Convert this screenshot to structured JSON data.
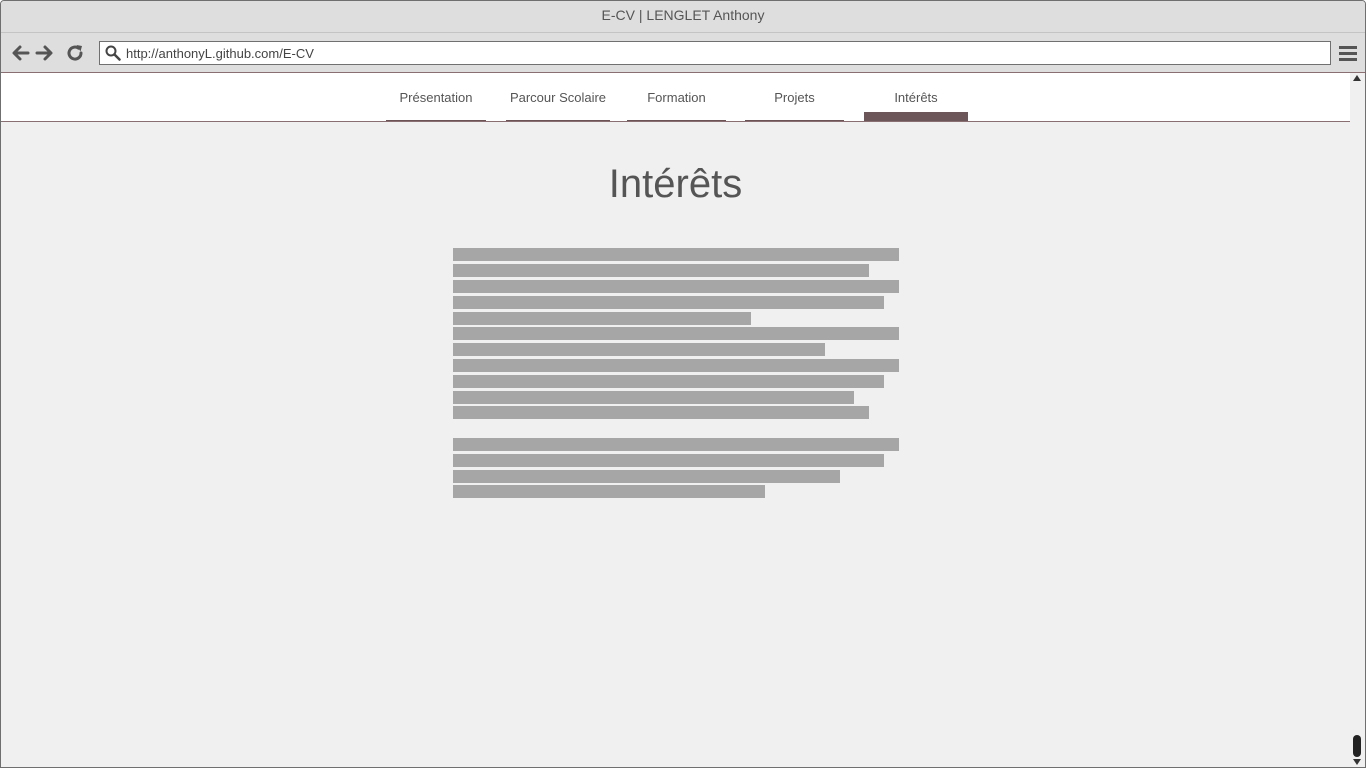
{
  "window": {
    "title": "E-CV | LENGLET Anthony"
  },
  "toolbar": {
    "url": "http://anthonyL.github.com/E-CV",
    "icons": [
      "arrow-left-icon",
      "arrow-right-icon",
      "refresh-icon",
      "search-icon",
      "hamburger-menu-icon"
    ]
  },
  "nav": {
    "tabs": [
      {
        "label": "Présentation",
        "active": false
      },
      {
        "label": "Parcour Scolaire",
        "active": false
      },
      {
        "label": "Formation",
        "active": false
      },
      {
        "label": "Projets",
        "active": false
      },
      {
        "label": "Intérêts",
        "active": true
      }
    ]
  },
  "main": {
    "heading": "Intérêts",
    "placeholder_paragraphs": [
      {
        "line_count": 11
      },
      {
        "line_count": 4
      }
    ]
  },
  "colors": {
    "accent": "#6d5659",
    "placeholder_text": "#a6a6a6",
    "page_background": "#f0f0f0"
  }
}
